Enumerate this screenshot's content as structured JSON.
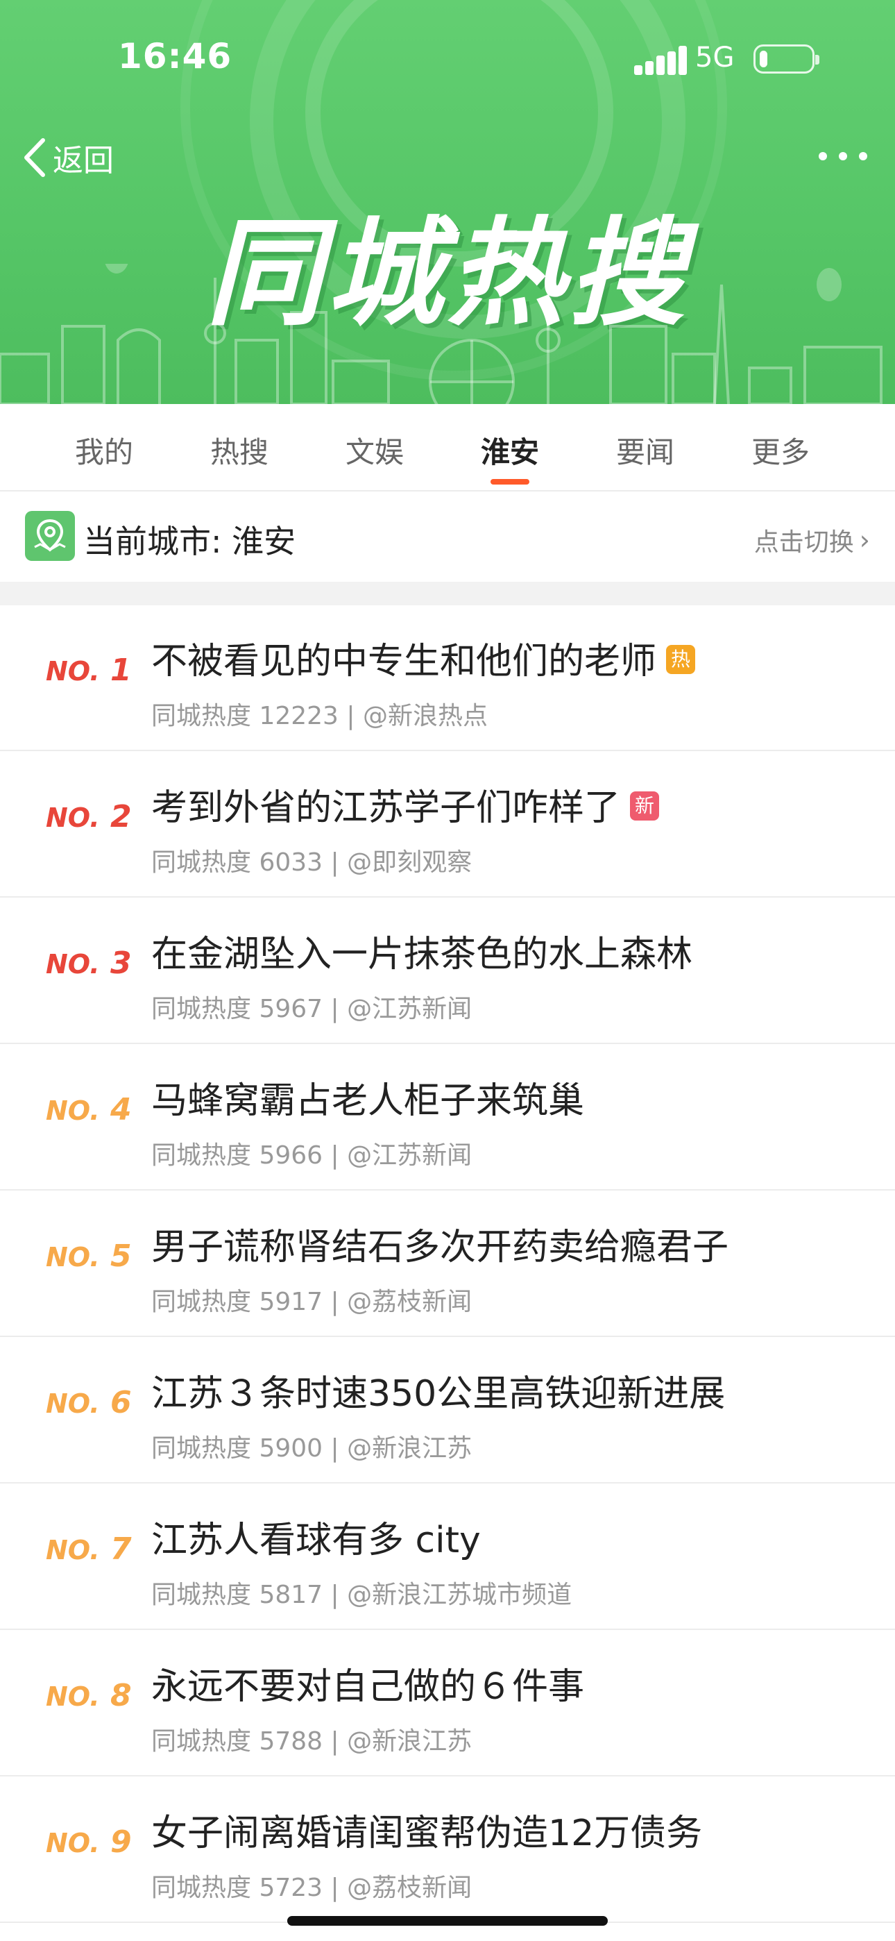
{
  "status_bar": {
    "time": "16:46",
    "network": "5G",
    "battery_percent": 15
  },
  "header": {
    "back_label": "返回",
    "hero_title": "同城热搜",
    "colors": {
      "primary": "#56c667"
    }
  },
  "tabs": [
    {
      "label": "我的",
      "active": false
    },
    {
      "label": "热搜",
      "active": false
    },
    {
      "label": "文娱",
      "active": false
    },
    {
      "label": "淮安",
      "active": true
    },
    {
      "label": "要闻",
      "active": false
    },
    {
      "label": "更多",
      "active": false
    }
  ],
  "city": {
    "current_label": "当前城市: 淮安",
    "switch_label": "点击切换",
    "icon": "location-pin-icon"
  },
  "list": [
    {
      "rank": "1",
      "title": "不被看见的中专生和他们的老师",
      "badge": "热",
      "badge_color": "#f5a623",
      "meta": "同城热度 12223 | @新浪热点",
      "rank_color": "#e8463a"
    },
    {
      "rank": "2",
      "title": "考到外省的江苏学子们咋样了",
      "badge": "新",
      "badge_color": "#ef5b6e",
      "meta": "同城热度 6033 | @即刻观察",
      "rank_color": "#e8463a"
    },
    {
      "rank": "3",
      "title": "在金湖坠入一片抹茶色的水上森林",
      "badge": "",
      "badge_color": "",
      "meta": "同城热度 5967 | @江苏新闻",
      "rank_color": "#e8463a"
    },
    {
      "rank": "4",
      "title": "马蜂窝霸占老人柜子来筑巢",
      "badge": "",
      "badge_color": "",
      "meta": "同城热度 5966 | @江苏新闻",
      "rank_color": "#f7a94a"
    },
    {
      "rank": "5",
      "title": "男子谎称肾结石多次开药卖给瘾君子",
      "badge": "",
      "badge_color": "",
      "meta": "同城热度 5917 | @荔枝新闻",
      "rank_color": "#f7a94a"
    },
    {
      "rank": "6",
      "title": "江苏３条时速350公里高铁迎新进展",
      "badge": "",
      "badge_color": "",
      "meta": "同城热度 5900 | @新浪江苏",
      "rank_color": "#f7a94a"
    },
    {
      "rank": "7",
      "title": "江苏人看球有多 city",
      "badge": "",
      "badge_color": "",
      "meta": "同城热度 5817 | @新浪江苏城市频道",
      "rank_color": "#f7a94a"
    },
    {
      "rank": "8",
      "title": "永远不要对自己做的６件事",
      "badge": "",
      "badge_color": "",
      "meta": "同城热度 5788 | @新浪江苏",
      "rank_color": "#f7a94a"
    },
    {
      "rank": "9",
      "title": "女子闹离婚请闺蜜帮伪造12万债务",
      "badge": "",
      "badge_color": "",
      "meta": "同城热度 5723 | @荔枝新闻",
      "rank_color": "#f7a94a"
    }
  ]
}
